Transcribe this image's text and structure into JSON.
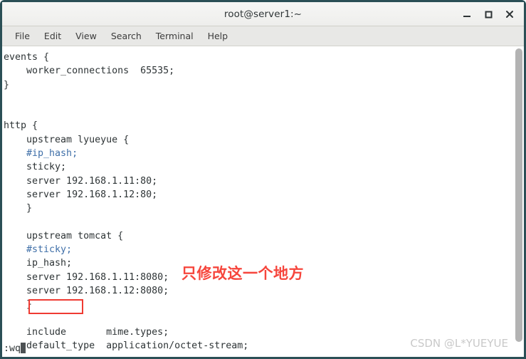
{
  "window": {
    "title": "root@server1:~",
    "controls": [
      {
        "name": "minimize",
        "label": "_"
      },
      {
        "name": "maximize",
        "label": "□"
      },
      {
        "name": "close",
        "label": "✕"
      }
    ]
  },
  "menubar": {
    "items": [
      {
        "label": "File"
      },
      {
        "label": "Edit"
      },
      {
        "label": "View"
      },
      {
        "label": "Search"
      },
      {
        "label": "Terminal"
      },
      {
        "label": "Help"
      }
    ]
  },
  "terminal": {
    "lines": [
      {
        "text": "events {",
        "comment": false
      },
      {
        "text": "    worker_connections  65535;",
        "comment": false
      },
      {
        "text": "}",
        "comment": false
      },
      {
        "text": "",
        "comment": false
      },
      {
        "text": "",
        "comment": false
      },
      {
        "text": "http {",
        "comment": false
      },
      {
        "text": "    upstream lyueyue {",
        "comment": false
      },
      {
        "text": "    #ip_hash;",
        "comment": true
      },
      {
        "text": "    sticky;",
        "comment": false
      },
      {
        "text": "    server 192.168.1.11:80;",
        "comment": false
      },
      {
        "text": "    server 192.168.1.12:80;",
        "comment": false
      },
      {
        "text": "    }",
        "comment": false
      },
      {
        "text": "",
        "comment": false
      },
      {
        "text": "    upstream tomcat {",
        "comment": false
      },
      {
        "text": "    #sticky;",
        "comment": true
      },
      {
        "text": "    ip_hash;",
        "comment": false
      },
      {
        "text": "    server 192.168.1.11:8080;",
        "comment": false
      },
      {
        "text": "    server 192.168.1.12:8080;",
        "comment": false
      },
      {
        "text": "    }",
        "comment": false
      },
      {
        "text": "",
        "comment": false
      },
      {
        "text": "    include       mime.types;",
        "comment": false
      },
      {
        "text": "    default_type  application/octet-stream;",
        "comment": false
      }
    ],
    "command_line": ":wq"
  },
  "annotations": {
    "note_text": "只修改这一个地方",
    "note_color": "#f6453c",
    "highlight_target": "ip_hash;",
    "highlight_color": "#ef3b32"
  },
  "watermark": {
    "text": "CSDN @L*YUEYUE"
  }
}
